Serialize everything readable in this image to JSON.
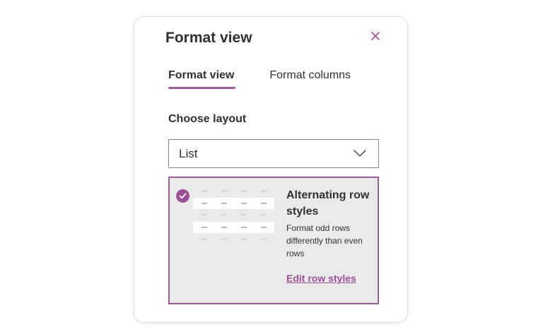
{
  "panel": {
    "title": "Format view",
    "close_icon": "close-icon"
  },
  "tabs": [
    {
      "label": "Format view",
      "active": true
    },
    {
      "label": "Format columns",
      "active": false
    }
  ],
  "layout": {
    "label": "Choose layout",
    "selected": "List",
    "chevron_icon": "chevron-down-icon"
  },
  "option_card": {
    "selected": true,
    "check_icon": "checkmark-circle-icon",
    "title": "Alternating row styles",
    "description": "Format odd rows differently than even rows",
    "link": "Edit row styles"
  },
  "colors": {
    "accent": "#9b4f96",
    "card_background": "#ebeaea",
    "text": "#323130"
  }
}
